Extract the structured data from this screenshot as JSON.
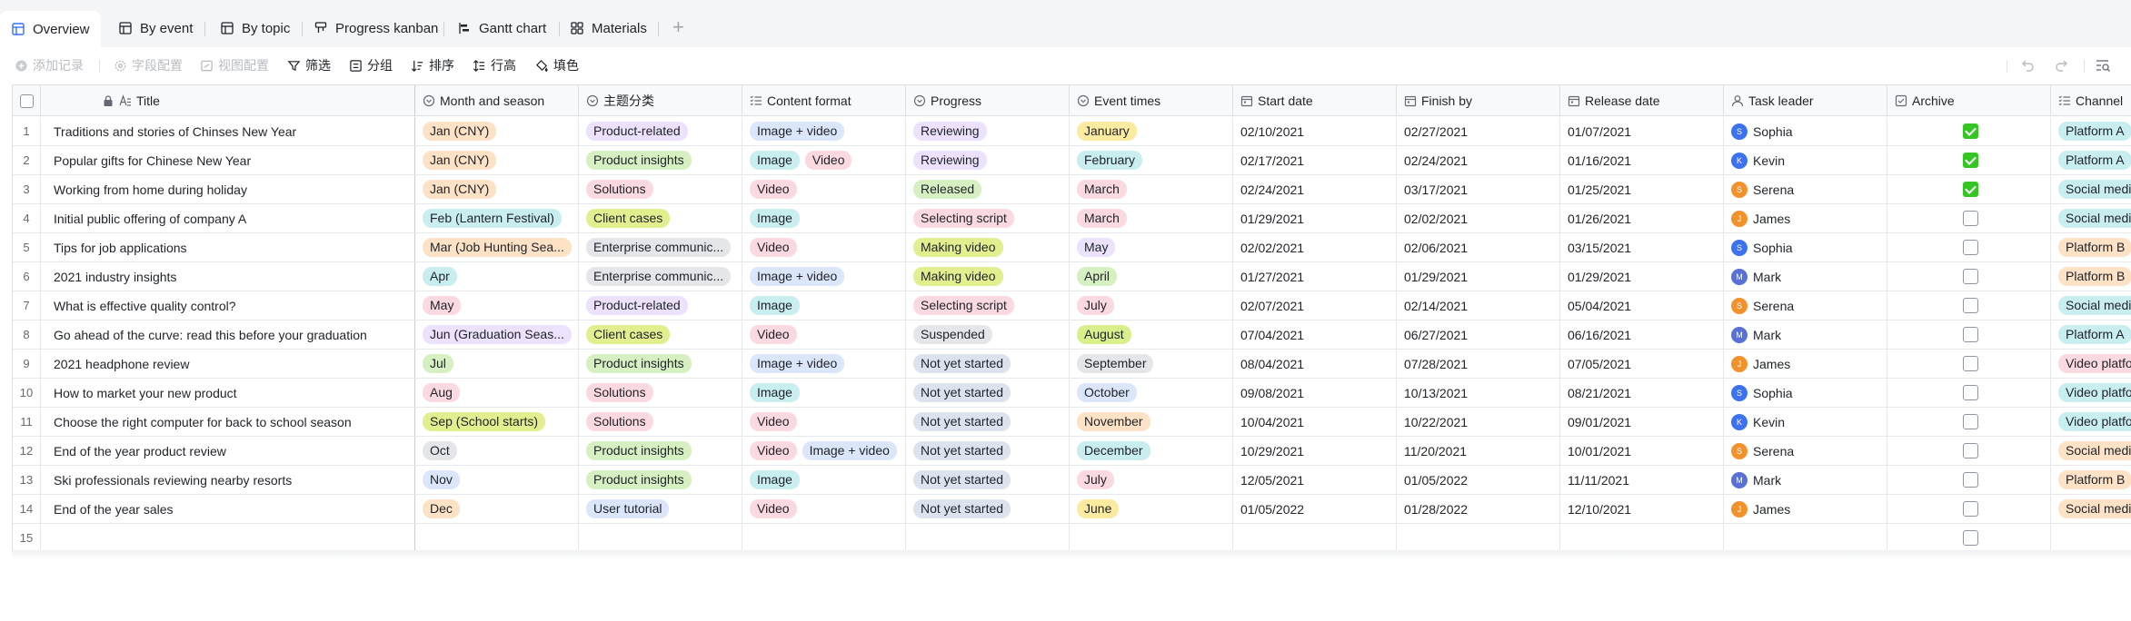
{
  "tabs": [
    {
      "label": "Overview",
      "icon": "grid-table-icon",
      "active": true
    },
    {
      "label": "By event",
      "icon": "grid-table-icon"
    },
    {
      "label": "By topic",
      "icon": "grid-table-icon"
    },
    {
      "label": "Progress kanban",
      "icon": "kanban-icon"
    },
    {
      "label": "Gantt chart",
      "icon": "gantt-icon"
    },
    {
      "label": "Materials",
      "icon": "gallery-icon"
    }
  ],
  "add_tab_label": "+",
  "toolbar": {
    "add_record": "添加记录",
    "field_config": "字段配置",
    "view_config": "视图配置",
    "filter": "筛选",
    "group": "分组",
    "sort": "排序",
    "row_height": "行高",
    "fill_color": "填色"
  },
  "columns": {
    "title": "Title",
    "month": "Month and season",
    "topic": "主题分类",
    "format": "Content format",
    "progress": "Progress",
    "event": "Event times",
    "start": "Start date",
    "finish": "Finish by",
    "release": "Release date",
    "leader": "Task leader",
    "archive": "Archive",
    "channel": "Channel"
  },
  "colors": {
    "orange": "#fde2c5",
    "purple": "#ece2fe",
    "blue": "#dbe6fb",
    "green": "#d7f0c2",
    "pink": "#fbd9e0",
    "teal": "#c9eef0",
    "olive": "#e3ef8e",
    "yellow": "#fbeba0",
    "gray": "#e4e6ea",
    "grayblue": "#dde3ee",
    "lime": "#d8ef8c",
    "avatar_blue": "#3c71f0",
    "avatar_orange": "#f2922d",
    "avatar_navy": "#5970d6",
    "checkbox_green": "#34c724"
  },
  "rows": [
    {
      "num": "1",
      "title": "Traditions and stories of Chinses New Year",
      "month": {
        "text": "Jan (CNY)",
        "c": "orange"
      },
      "topic": {
        "text": "Product-related",
        "c": "purple"
      },
      "formats": [
        {
          "text": "Image + video",
          "c": "blue"
        }
      ],
      "progress": {
        "text": "Reviewing",
        "c": "purple"
      },
      "event": {
        "text": "January",
        "c": "yellow"
      },
      "start": "02/10/2021",
      "finish": "02/27/2021",
      "release": "01/07/2021",
      "leader": {
        "name": "Sophia",
        "c": "avatar_blue"
      },
      "archive": true,
      "channels": [
        {
          "text": "Platform A",
          "c": "teal"
        }
      ]
    },
    {
      "num": "2",
      "title": "Popular gifts for Chinese New Year",
      "month": {
        "text": "Jan (CNY)",
        "c": "orange"
      },
      "topic": {
        "text": "Product insights",
        "c": "green"
      },
      "formats": [
        {
          "text": "Image",
          "c": "teal"
        },
        {
          "text": "Video",
          "c": "pink"
        }
      ],
      "progress": {
        "text": "Reviewing",
        "c": "purple"
      },
      "event": {
        "text": "February",
        "c": "teal"
      },
      "start": "02/17/2021",
      "finish": "02/24/2021",
      "release": "01/16/2021",
      "leader": {
        "name": "Kevin",
        "c": "avatar_blue"
      },
      "archive": true,
      "channels": [
        {
          "text": "Platform A",
          "c": "teal"
        },
        {
          "text": "",
          "c": "orange"
        }
      ]
    },
    {
      "num": "3",
      "title": "Working from home during holiday",
      "month": {
        "text": "Jan (CNY)",
        "c": "orange"
      },
      "topic": {
        "text": "Solutions",
        "c": "pink"
      },
      "formats": [
        {
          "text": "Video",
          "c": "pink"
        }
      ],
      "progress": {
        "text": "Released",
        "c": "green"
      },
      "event": {
        "text": "March",
        "c": "pink"
      },
      "start": "02/24/2021",
      "finish": "03/17/2021",
      "release": "01/25/2021",
      "leader": {
        "name": "Serena",
        "c": "avatar_orange"
      },
      "archive": true,
      "channels": [
        {
          "text": "Social media A",
          "c": "teal"
        }
      ]
    },
    {
      "num": "4",
      "title": "Initial public offering of company A",
      "month": {
        "text": "Feb (Lantern Festival)",
        "c": "teal"
      },
      "topic": {
        "text": "Client cases",
        "c": "olive"
      },
      "formats": [
        {
          "text": "Image",
          "c": "teal"
        }
      ],
      "progress": {
        "text": "Selecting script",
        "c": "pink"
      },
      "event": {
        "text": "March",
        "c": "pink"
      },
      "start": "01/29/2021",
      "finish": "02/02/2021",
      "release": "01/26/2021",
      "leader": {
        "name": "James",
        "c": "avatar_orange"
      },
      "archive": false,
      "channels": [
        {
          "text": "Social media A",
          "c": "teal"
        }
      ]
    },
    {
      "num": "5",
      "title": "Tips for job applications",
      "month": {
        "text": "Mar (Job Hunting Sea...",
        "c": "orange"
      },
      "topic": {
        "text": "Enterprise communic...",
        "c": "gray"
      },
      "formats": [
        {
          "text": "Video",
          "c": "pink"
        }
      ],
      "progress": {
        "text": "Making video",
        "c": "olive"
      },
      "event": {
        "text": "May",
        "c": "purple"
      },
      "start": "02/02/2021",
      "finish": "02/06/2021",
      "release": "03/15/2021",
      "leader": {
        "name": "Sophia",
        "c": "avatar_blue"
      },
      "archive": false,
      "channels": [
        {
          "text": "Platform B",
          "c": "orange"
        },
        {
          "text": "",
          "c": "orange"
        }
      ]
    },
    {
      "num": "6",
      "title": "2021 industry insights",
      "month": {
        "text": "Apr",
        "c": "teal"
      },
      "topic": {
        "text": "Enterprise communic...",
        "c": "gray"
      },
      "formats": [
        {
          "text": "Image + video",
          "c": "blue"
        }
      ],
      "progress": {
        "text": "Making video",
        "c": "olive"
      },
      "event": {
        "text": "April",
        "c": "green"
      },
      "start": "01/27/2021",
      "finish": "01/29/2021",
      "release": "01/29/2021",
      "leader": {
        "name": "Mark",
        "c": "avatar_navy"
      },
      "archive": false,
      "channels": [
        {
          "text": "Platform B",
          "c": "orange"
        },
        {
          "text": "",
          "c": "orange"
        }
      ]
    },
    {
      "num": "7",
      "title": "What is effective quality control?",
      "month": {
        "text": "May",
        "c": "pink"
      },
      "topic": {
        "text": "Product-related",
        "c": "purple"
      },
      "formats": [
        {
          "text": "Image",
          "c": "teal"
        }
      ],
      "progress": {
        "text": "Selecting script",
        "c": "pink"
      },
      "event": {
        "text": "July",
        "c": "pink"
      },
      "start": "02/07/2021",
      "finish": "02/14/2021",
      "release": "05/04/2021",
      "leader": {
        "name": "Serena",
        "c": "avatar_orange"
      },
      "archive": false,
      "channels": [
        {
          "text": "Social media A",
          "c": "teal"
        }
      ]
    },
    {
      "num": "8",
      "title": "Go ahead of the curve: read this before your graduation",
      "month": {
        "text": "Jun (Graduation Seas...",
        "c": "purple"
      },
      "topic": {
        "text": "Client cases",
        "c": "olive"
      },
      "formats": [
        {
          "text": "Video",
          "c": "pink"
        }
      ],
      "progress": {
        "text": "Suspended",
        "c": "gray"
      },
      "event": {
        "text": "August",
        "c": "lime"
      },
      "start": "07/04/2021",
      "finish": "06/27/2021",
      "release": "06/16/2021",
      "leader": {
        "name": "Mark",
        "c": "avatar_navy"
      },
      "archive": false,
      "channels": [
        {
          "text": "Platform A",
          "c": "teal"
        }
      ]
    },
    {
      "num": "9",
      "title": "2021 headphone review",
      "month": {
        "text": "Jul",
        "c": "green"
      },
      "topic": {
        "text": "Product insights",
        "c": "green"
      },
      "formats": [
        {
          "text": "Image + video",
          "c": "blue"
        }
      ],
      "progress": {
        "text": "Not yet started",
        "c": "grayblue"
      },
      "event": {
        "text": "September",
        "c": "gray"
      },
      "start": "08/04/2021",
      "finish": "07/28/2021",
      "release": "07/05/2021",
      "leader": {
        "name": "James",
        "c": "avatar_orange"
      },
      "archive": false,
      "channels": [
        {
          "text": "Video platform",
          "c": "pink"
        }
      ]
    },
    {
      "num": "10",
      "title": "How to market your new product",
      "month": {
        "text": "Aug",
        "c": "pink"
      },
      "topic": {
        "text": "Solutions",
        "c": "pink"
      },
      "formats": [
        {
          "text": "Image",
          "c": "teal"
        }
      ],
      "progress": {
        "text": "Not yet started",
        "c": "grayblue"
      },
      "event": {
        "text": "October",
        "c": "blue"
      },
      "start": "09/08/2021",
      "finish": "10/13/2021",
      "release": "08/21/2021",
      "leader": {
        "name": "Sophia",
        "c": "avatar_blue"
      },
      "archive": false,
      "channels": [
        {
          "text": "Video platform",
          "c": "teal"
        }
      ]
    },
    {
      "num": "11",
      "title": "Choose the right computer for back to school season",
      "month": {
        "text": "Sep (School starts)",
        "c": "olive"
      },
      "topic": {
        "text": "Solutions",
        "c": "pink"
      },
      "formats": [
        {
          "text": "Video",
          "c": "pink"
        }
      ],
      "progress": {
        "text": "Not yet started",
        "c": "grayblue"
      },
      "event": {
        "text": "November",
        "c": "orange"
      },
      "start": "10/04/2021",
      "finish": "10/22/2021",
      "release": "09/01/2021",
      "leader": {
        "name": "Kevin",
        "c": "avatar_blue"
      },
      "archive": false,
      "channels": [
        {
          "text": "Video platform",
          "c": "teal"
        }
      ]
    },
    {
      "num": "12",
      "title": "End of the year product review",
      "month": {
        "text": "Oct",
        "c": "gray"
      },
      "topic": {
        "text": "Product insights",
        "c": "green"
      },
      "formats": [
        {
          "text": "Video",
          "c": "pink"
        },
        {
          "text": "Image + video",
          "c": "blue"
        }
      ],
      "progress": {
        "text": "Not yet started",
        "c": "grayblue"
      },
      "event": {
        "text": "December",
        "c": "teal"
      },
      "start": "10/29/2021",
      "finish": "11/20/2021",
      "release": "10/01/2021",
      "leader": {
        "name": "Serena",
        "c": "avatar_orange"
      },
      "archive": false,
      "channels": [
        {
          "text": "Social media B",
          "c": "orange"
        }
      ]
    },
    {
      "num": "13",
      "title": "Ski professionals reviewing nearby resorts",
      "month": {
        "text": "Nov",
        "c": "blue"
      },
      "topic": {
        "text": "Product insights",
        "c": "green"
      },
      "formats": [
        {
          "text": "Image",
          "c": "teal"
        }
      ],
      "progress": {
        "text": "Not yet started",
        "c": "grayblue"
      },
      "event": {
        "text": "July",
        "c": "pink"
      },
      "start": "12/05/2021",
      "finish": "01/05/2022",
      "release": "11/11/2021",
      "leader": {
        "name": "Mark",
        "c": "avatar_navy"
      },
      "archive": false,
      "channels": [
        {
          "text": "Platform B",
          "c": "orange"
        }
      ]
    },
    {
      "num": "14",
      "title": "End of the year sales",
      "month": {
        "text": "Dec",
        "c": "orange"
      },
      "topic": {
        "text": "User tutorial",
        "c": "blue"
      },
      "formats": [
        {
          "text": "Video",
          "c": "pink"
        }
      ],
      "progress": {
        "text": "Not yet started",
        "c": "grayblue"
      },
      "event": {
        "text": "June",
        "c": "yellow"
      },
      "start": "01/05/2022",
      "finish": "01/28/2022",
      "release": "12/10/2021",
      "leader": {
        "name": "James",
        "c": "avatar_orange"
      },
      "archive": false,
      "channels": [
        {
          "text": "Social media B",
          "c": "orange"
        }
      ]
    }
  ],
  "empty_row_num": "15"
}
